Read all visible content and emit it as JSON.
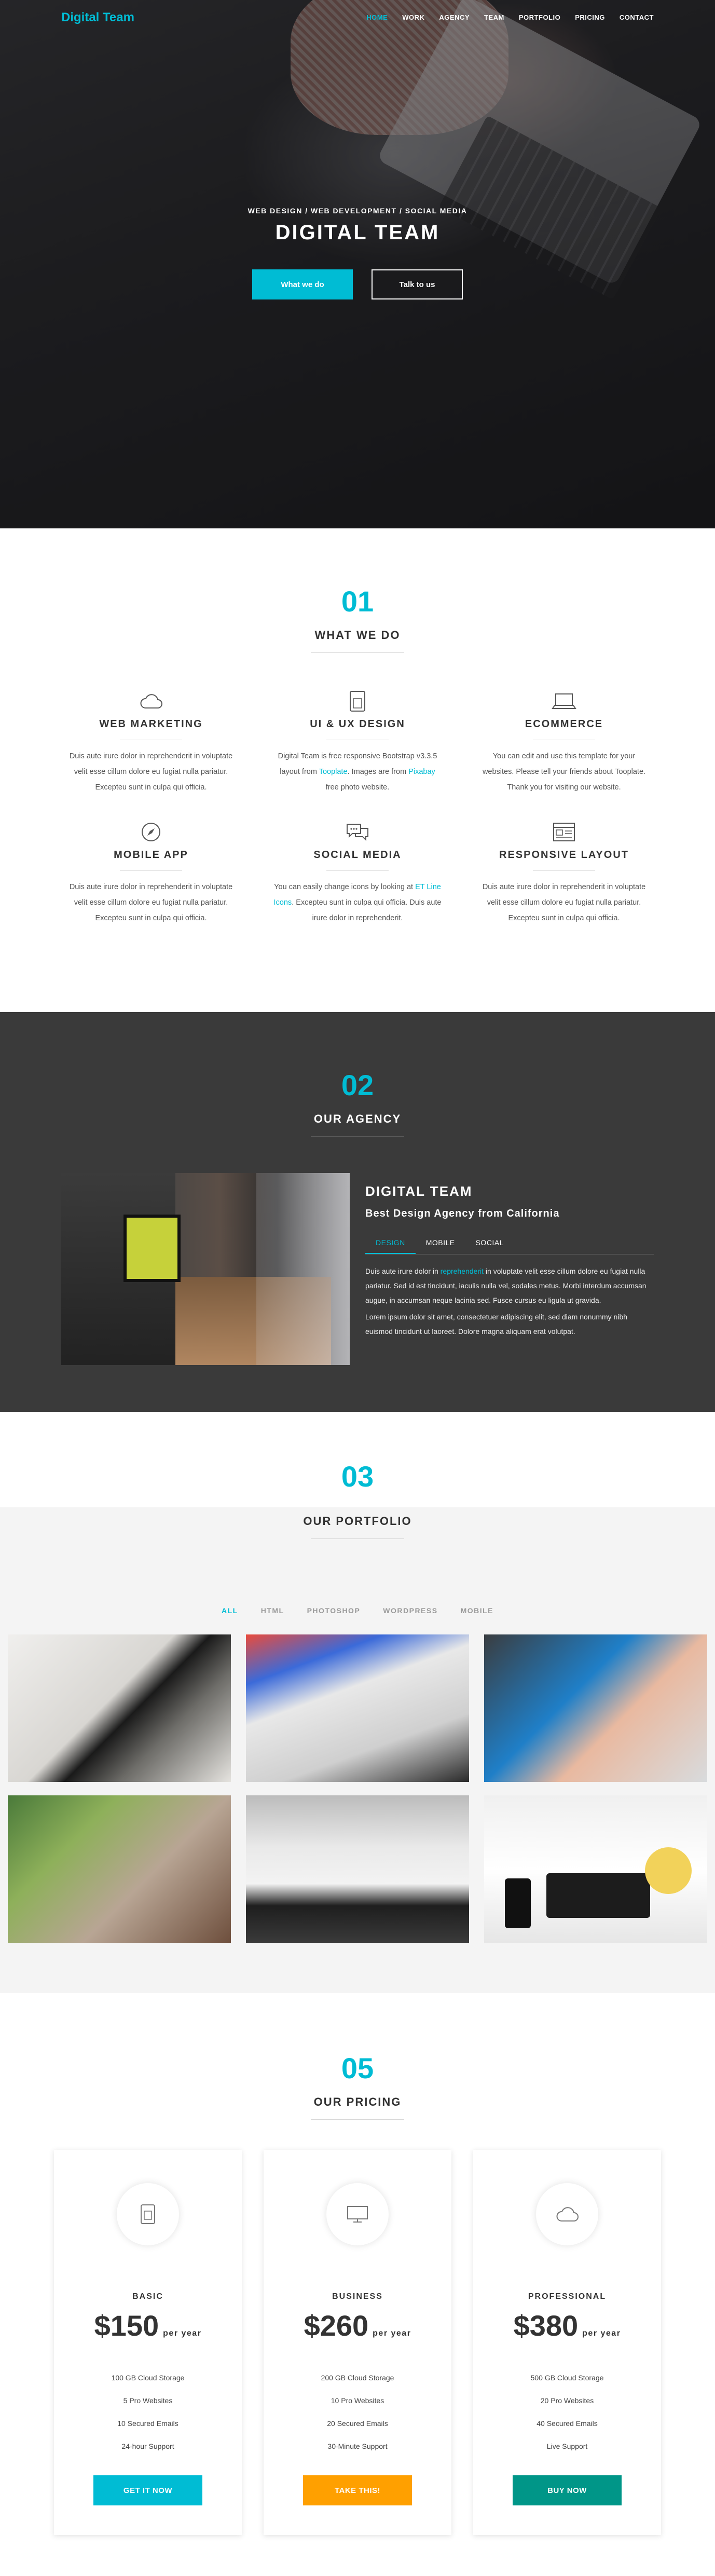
{
  "brand": {
    "name": "Digital Team",
    "accent": "#00bcd4"
  },
  "nav": {
    "items": [
      "HOME",
      "WORK",
      "AGENCY",
      "TEAM",
      "PORTFOLIO",
      "PRICING",
      "CONTACT"
    ],
    "active": "HOME"
  },
  "hero": {
    "subtitle": "WEB DESIGN / WEB DEVELOPMENT / SOCIAL MEDIA",
    "title": "DIGITAL TEAM",
    "btn_primary": "What we do",
    "btn_secondary": "Talk to us"
  },
  "services": {
    "number": "01",
    "title": "WHAT WE DO",
    "items": [
      {
        "icon": "cloud-icon",
        "title": "WEB MARKETING",
        "lines": [
          "Duis aute irure dolor in reprehenderit in voluptate",
          "velit esse cillum dolore eu fugiat nulla pariatur.",
          "Excepteu sunt in culpa qui officia."
        ]
      },
      {
        "icon": "tablet-icon",
        "title": "UI & UX DESIGN",
        "line1": "Digital Team is free responsive Bootstrap v3.3.5",
        "line2a": "layout from ",
        "link1": "Tooplate",
        "line2b": ". Images are from ",
        "link2": "Pixabay",
        "line3": "free photo website."
      },
      {
        "icon": "laptop-icon",
        "title": "ECOMMERCE",
        "lines": [
          "You can edit and use this template for your",
          "websites. Please tell your friends about Tooplate.",
          "Thank you for visiting our website."
        ]
      },
      {
        "icon": "compass-icon",
        "title": "MOBILE APP",
        "lines": [
          "Duis aute irure dolor in reprehenderit in voluptate",
          "velit esse cillum dolore eu fugiat nulla pariatur.",
          "Excepteu sunt in culpa qui officia."
        ]
      },
      {
        "icon": "chat-icon",
        "title": "SOCIAL MEDIA",
        "line1a": "You can easily change icons by looking at ",
        "link1": "ET Line",
        "line2a": "Icons",
        "line2b": ". Excepteu sunt in culpa qui officia. Duis aute",
        "line3": "irure dolor in reprehenderit."
      },
      {
        "icon": "layout-icon",
        "title": "RESPONSIVE LAYOUT",
        "lines": [
          "Duis aute irure dolor in reprehenderit in voluptate",
          "velit esse cillum dolore eu fugiat nulla pariatur.",
          "Excepteu sunt in culpa qui officia."
        ]
      }
    ]
  },
  "agency": {
    "number": "02",
    "title": "OUR AGENCY",
    "heading": "DIGITAL TEAM",
    "subheading": "Best Design Agency from California",
    "tabs": [
      "DESIGN",
      "MOBILE",
      "SOCIAL"
    ],
    "active_tab": "DESIGN",
    "p1_a": "Duis aute irure dolor in ",
    "p1_link": "reprehenderit",
    "p1_b": " in voluptate velit esse cillum dolore eu fugiat nulla pariatur. Sed id est tincidunt, iaculis nulla vel, sodales metus. Morbi interdum accumsan augue, in accumsan neque lacinia sed. Fusce cursus eu ligula ut gravida.",
    "p2": "Lorem ipsum dolor sit amet, consectetuer adipiscing elit, sed diam nonummy nibh euismod tincidunt ut laoreet. Dolore magna aliquam erat volutpat."
  },
  "portfolio": {
    "number": "03",
    "title": "OUR PORTFOLIO",
    "filters": [
      "ALL",
      "HTML",
      "PHOTOSHOP",
      "WORDPRESS",
      "MOBILE"
    ],
    "active_filter": "ALL"
  },
  "pricing": {
    "number": "05",
    "title": "OUR PRICING",
    "per": "per year",
    "plans": [
      {
        "name": "BASIC",
        "icon": "tablet-icon",
        "price": "$150",
        "features": [
          "100 GB Cloud Storage",
          "5 Pro Websites",
          "10 Secured Emails",
          "24-hour Support"
        ],
        "button": "GET IT NOW",
        "color": "#00bcd4"
      },
      {
        "name": "BUSINESS",
        "icon": "monitor-icon",
        "price": "$260",
        "features": [
          "200 GB Cloud Storage",
          "10 Pro Websites",
          "20 Secured Emails",
          "30-Minute Support"
        ],
        "button": "TAKE THIS!",
        "color": "#ffa000"
      },
      {
        "name": "PROFESSIONAL",
        "icon": "cloud-icon",
        "price": "$380",
        "features": [
          "500 GB Cloud Storage",
          "20 Pro Websites",
          "40 Secured Emails",
          "Live Support"
        ],
        "button": "BUY NOW",
        "color": "#009688"
      }
    ]
  }
}
